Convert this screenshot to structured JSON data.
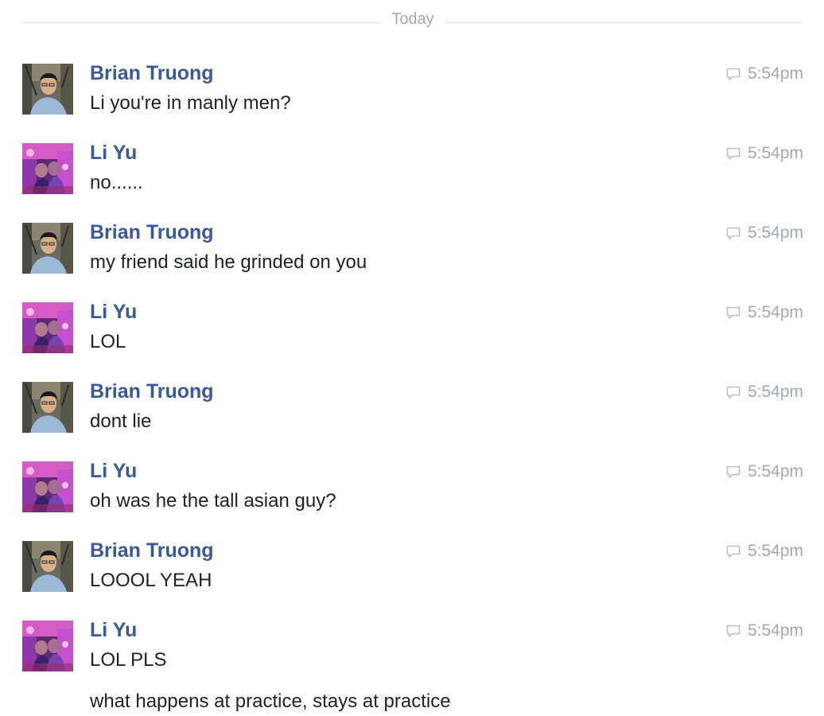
{
  "divider_label": "Today",
  "messages": [
    {
      "sender": "Brian Truong",
      "text": "Li you're in manly men?",
      "time": "5:54pm",
      "avatar": "brian"
    },
    {
      "sender": "Li Yu",
      "text": "no......",
      "time": "5:54pm",
      "avatar": "li"
    },
    {
      "sender": "Brian Truong",
      "text": "my friend said he grinded on you",
      "time": "5:54pm",
      "avatar": "brian"
    },
    {
      "sender": "Li Yu",
      "text": "LOL",
      "time": "5:54pm",
      "avatar": "li"
    },
    {
      "sender": "Brian Truong",
      "text": "dont lie",
      "time": "5:54pm",
      "avatar": "brian"
    },
    {
      "sender": "Li Yu",
      "text": "oh was he the tall asian guy?",
      "time": "5:54pm",
      "avatar": "li"
    },
    {
      "sender": "Brian Truong",
      "text": "LOOOL YEAH",
      "time": "5:54pm",
      "avatar": "brian"
    },
    {
      "sender": "Li Yu",
      "text": "LOL PLS",
      "time": "5:54pm",
      "avatar": "li"
    }
  ],
  "continuation": "what happens at practice, stays at practice",
  "colors": {
    "sender_name": "#3b5998",
    "message_text": "#1d2129",
    "timestamp": "#a3a8b2",
    "divider_line": "#e3e5ea"
  }
}
